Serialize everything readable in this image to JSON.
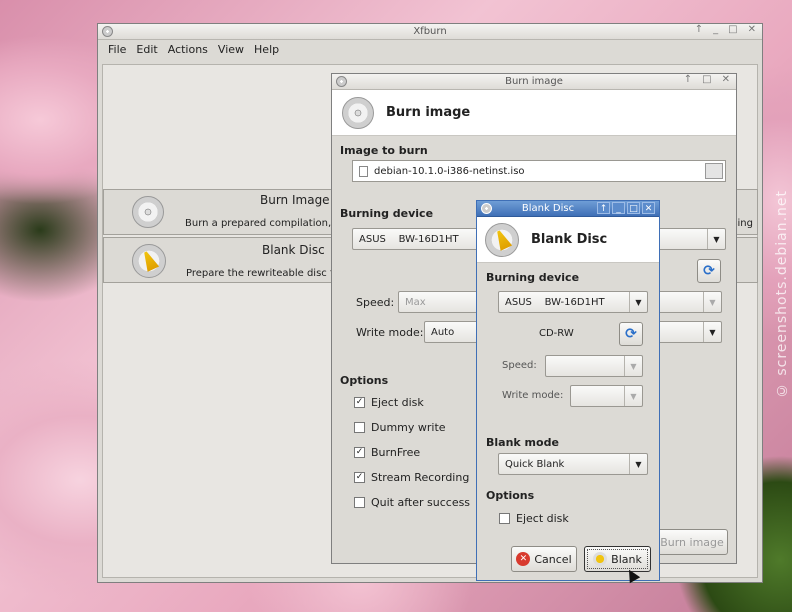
{
  "watermark": "© screenshots.debian.net",
  "main_window": {
    "title": "Xfburn",
    "controls": [
      "↑",
      "_",
      "□",
      "✕"
    ],
    "menu": [
      "File",
      "Edit",
      "Actions",
      "View",
      "Help"
    ],
    "actions": [
      {
        "title": "Burn Image",
        "desc": "Burn a prepared compilation,",
        "icon": "disc-icon"
      },
      {
        "title": "Blank Disc",
        "desc": "Prepare the rewriteable disc f",
        "icon": "broom-icon"
      }
    ],
    "right_cutoff_text": "sing"
  },
  "burn_dialog": {
    "title": "Burn image",
    "controls": [
      "↑",
      "□",
      "✕"
    ],
    "header_title": "Burn image",
    "image_section": "Image to burn",
    "image_file": "debian-10.1.0-i386-netinst.iso",
    "device_section": "Burning device",
    "device": "ASUS    BW-16D1HT",
    "speed_label": "Speed:",
    "speed_value": "Max",
    "write_mode_label": "Write mode:",
    "write_mode_value": "Auto",
    "options_section": "Options",
    "options": [
      {
        "label": "Eject disk",
        "checked": true
      },
      {
        "label": "Dummy write",
        "checked": false
      },
      {
        "label": "BurnFree",
        "checked": true
      },
      {
        "label": "Stream Recording",
        "checked": true
      },
      {
        "label": "Quit after success",
        "checked": false
      }
    ],
    "burn_button": "Burn image"
  },
  "blank_dialog": {
    "title": "Blank Disc",
    "controls": [
      "↑",
      "_",
      "□",
      "✕"
    ],
    "header_title": "Blank Disc",
    "device_section": "Burning device",
    "device": "ASUS    BW-16D1HT",
    "media": "CD-RW",
    "speed_label": "Speed:",
    "speed_value": "",
    "write_mode_label": "Write mode:",
    "write_mode_value": "",
    "blank_mode_section": "Blank mode",
    "blank_mode_value": "Quick Blank",
    "options_section": "Options",
    "eject_label": "Eject disk",
    "eject_checked": false,
    "cancel_button": "Cancel",
    "blank_button": "Blank"
  }
}
